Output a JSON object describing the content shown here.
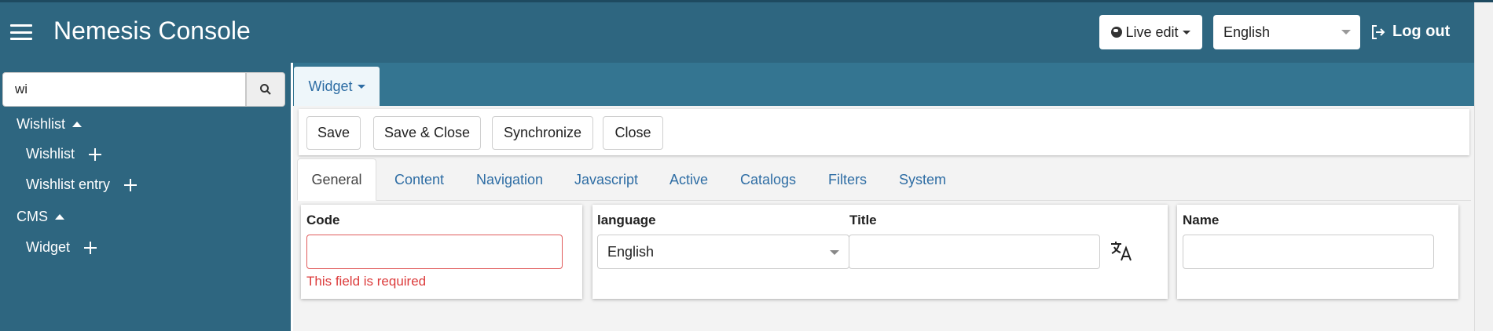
{
  "header": {
    "title": "Nemesis Console",
    "live_edit_label": "Live edit",
    "language_value": "English",
    "logout_label": "Log out"
  },
  "sidebar": {
    "search_value": "wi",
    "groups": [
      {
        "label": "Wishlist",
        "items": [
          {
            "label": "Wishlist"
          },
          {
            "label": "Wishlist entry"
          }
        ]
      },
      {
        "label": "CMS",
        "items": [
          {
            "label": "Widget"
          }
        ]
      }
    ]
  },
  "module": {
    "label": "Widget"
  },
  "toolbar": {
    "save_label": "Save",
    "save_close_label": "Save & Close",
    "synchronize_label": "Synchronize",
    "close_label": "Close"
  },
  "tabs": [
    {
      "label": "General"
    },
    {
      "label": "Content"
    },
    {
      "label": "Navigation"
    },
    {
      "label": "Javascript"
    },
    {
      "label": "Active"
    },
    {
      "label": "Catalogs"
    },
    {
      "label": "Filters"
    },
    {
      "label": "System"
    }
  ],
  "form": {
    "code": {
      "label": "Code",
      "value": "",
      "error": "This field is required"
    },
    "language": {
      "label": "language",
      "value": "English"
    },
    "title": {
      "label": "Title",
      "value": ""
    },
    "name": {
      "label": "Name",
      "value": ""
    }
  },
  "colors": {
    "header_bg": "#2e6680",
    "module_bar_bg": "#347591",
    "link": "#2e6da4",
    "error": "#dc3b3b"
  }
}
